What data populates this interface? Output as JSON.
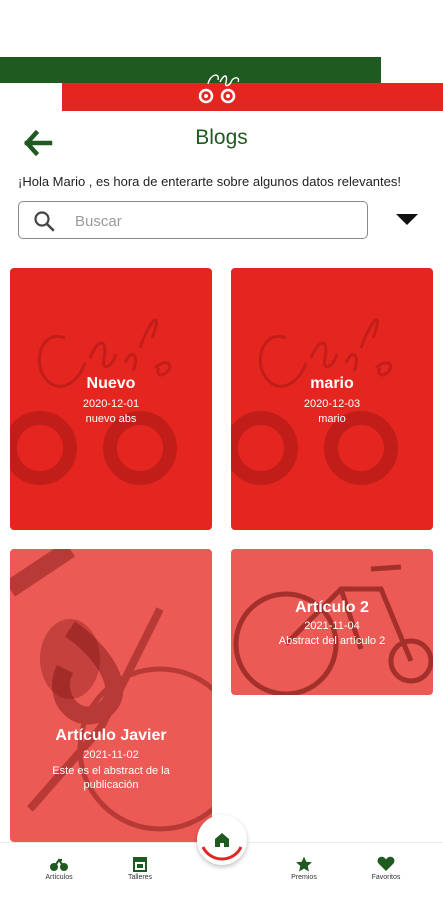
{
  "header": {
    "title": "Blogs",
    "greeting": "¡Hola Mario , es hora de enterarte sobre algunos datos relevantes!"
  },
  "search": {
    "placeholder": "Buscar",
    "value": ""
  },
  "colors": {
    "green": "#1f5a20",
    "red": "#e52620"
  },
  "cards": [
    {
      "title": "Nuevo",
      "date": "2020-12-01",
      "abstract": "nuevo abs"
    },
    {
      "title": "mario",
      "date": "2020-12-03",
      "abstract": "mario"
    },
    {
      "title": "Artículo Javier",
      "date": "2021-11-02",
      "abstract_line1": "Este es el abstract de la",
      "abstract_line2": "publicación"
    },
    {
      "title": "Artículo 2",
      "date": "2021-11-04",
      "abstract": "Abstract del artículo 2"
    }
  ],
  "bottom_nav": {
    "items": [
      {
        "label": "Artículos",
        "icon": "bike-icon"
      },
      {
        "label": "Talleres",
        "icon": "store-icon"
      },
      {
        "label": "Premios",
        "icon": "star-icon"
      },
      {
        "label": "Favoritos",
        "icon": "heart-icon"
      }
    ],
    "center_icon": "home-icon"
  }
}
